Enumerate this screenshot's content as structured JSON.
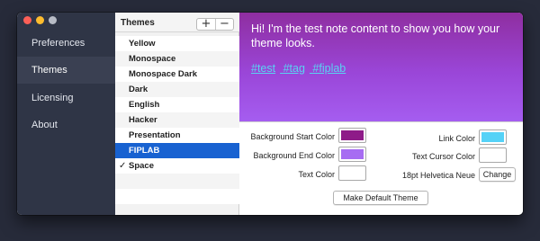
{
  "sidebar": {
    "items": [
      {
        "label": "Preferences",
        "active": false
      },
      {
        "label": "Themes",
        "active": true
      },
      {
        "label": "Licensing",
        "active": false
      },
      {
        "label": "About",
        "active": false
      }
    ]
  },
  "themes": {
    "title": "Themes",
    "add_label": "+",
    "remove_label": "−",
    "check_mark": "✓",
    "list": [
      "Yellow",
      "Monospace",
      "Monospace Dark",
      "Dark",
      "English",
      "Hacker",
      "Presentation",
      "FIPLAB",
      "Space"
    ],
    "selected": "FIPLAB",
    "checked": "Space"
  },
  "preview": {
    "text": "Hi! I'm the test note content to show you how your theme looks.",
    "tags": [
      "#test",
      "#tag",
      "#fiplab"
    ]
  },
  "settings": {
    "bg_start_label": "Background Start Color",
    "bg_end_label": "Background End Color",
    "text_color_label": "Text Color",
    "link_color_label": "Link Color",
    "cursor_color_label": "Text Cursor Color",
    "font_label": "18pt Helvetica Neue",
    "change_button": "Change",
    "default_button": "Make Default Theme",
    "colors": {
      "bg_start": "#8e1b88",
      "bg_end": "#a76cf2",
      "text": "#ffffff",
      "link": "#55d2f7",
      "cursor": "#ffffff"
    }
  }
}
